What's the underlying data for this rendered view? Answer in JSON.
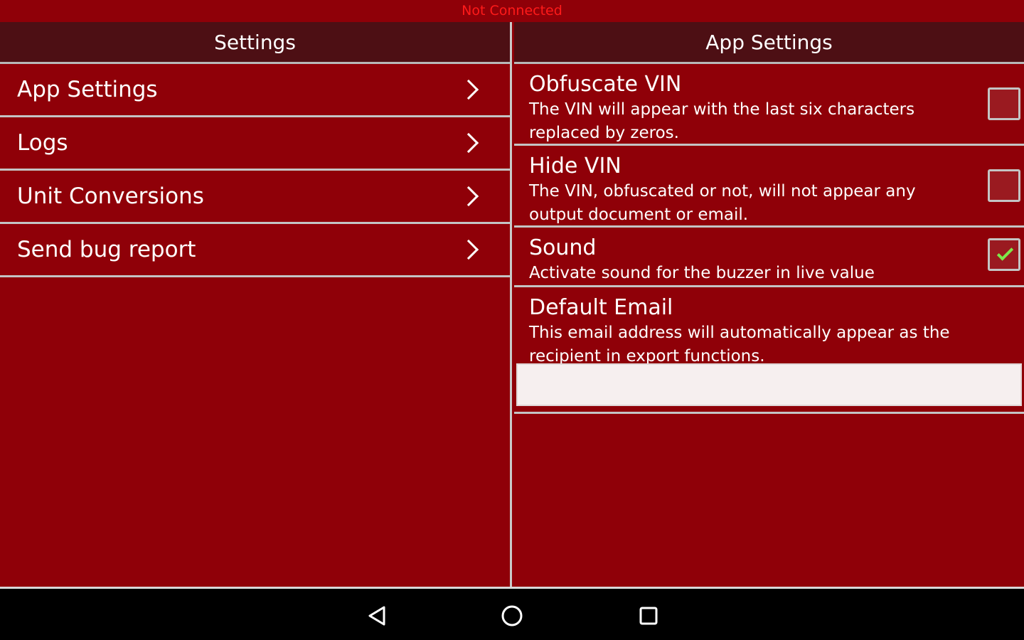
{
  "status": {
    "connection": "Not Connected"
  },
  "left_pane": {
    "header": "Settings",
    "items": [
      {
        "label": "App Settings"
      },
      {
        "label": "Logs"
      },
      {
        "label": "Unit Conversions"
      },
      {
        "label": "Send bug report"
      }
    ]
  },
  "right_pane": {
    "header": "App Settings",
    "prefs": [
      {
        "title": "Obfuscate VIN",
        "summary": "The VIN will appear with the last six characters replaced by zeros.",
        "checked": false
      },
      {
        "title": "Hide VIN",
        "summary": "The VIN, obfuscated or not, will not appear any output document or email.",
        "checked": false
      },
      {
        "title": "Sound",
        "summary": "Activate sound for the buzzer in live value",
        "checked": true
      }
    ],
    "email": {
      "title": "Default Email",
      "summary": "This email address will automatically appear as the recipient in export functions.",
      "value": "",
      "placeholder": ""
    }
  },
  "system_nav": {
    "back_icon": "back-triangle-icon",
    "home_icon": "home-circle-icon",
    "recents_icon": "recents-square-icon"
  },
  "colors": {
    "background": "#8f0008",
    "header": "#4d0f14",
    "status_text": "#ff1a1a",
    "check": "#7de84a"
  }
}
